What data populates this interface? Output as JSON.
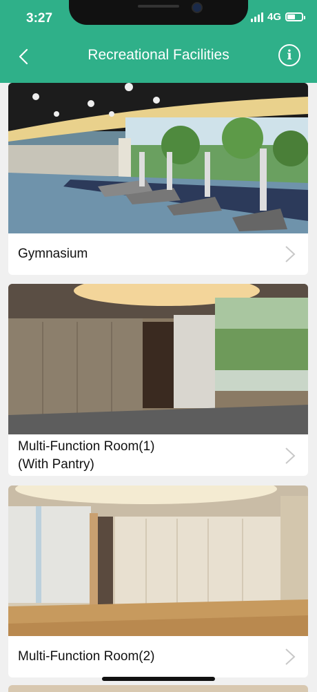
{
  "status_bar": {
    "time": "3:27",
    "network": "4G"
  },
  "header": {
    "title": "Recreational Facilities",
    "info_icon": "info-icon",
    "back_icon": "chevron-left-icon"
  },
  "facilities": [
    {
      "name": "Gymnasium"
    },
    {
      "name_line1": "Multi-Function Room(1)",
      "name_line2": "(With Pantry)"
    },
    {
      "name": "Multi-Function Room(2)"
    }
  ],
  "colors": {
    "header": "#2fb089",
    "background": "#f0f0f0"
  }
}
